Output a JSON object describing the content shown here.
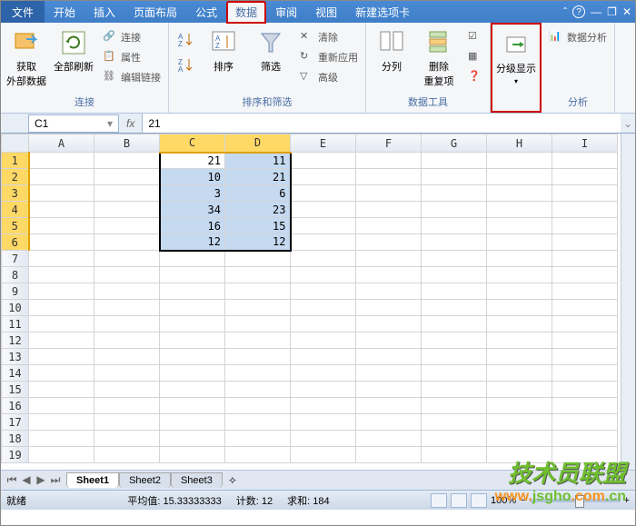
{
  "tabs": {
    "file": "文件",
    "items": [
      "开始",
      "插入",
      "页面布局",
      "公式",
      "数据",
      "审阅",
      "视图",
      "新建选项卡"
    ],
    "active": "数据"
  },
  "ribbon": {
    "group1": {
      "label": "连接",
      "get_external": "获取\n外部数据",
      "refresh_all": "全部刷新",
      "connections": "连接",
      "properties": "属性",
      "edit_links": "编辑链接"
    },
    "group2": {
      "label": "排序和筛选",
      "sort": "排序",
      "filter": "筛选",
      "clear": "清除",
      "reapply": "重新应用",
      "advanced": "高级"
    },
    "group3": {
      "label": "数据工具",
      "text_to_cols": "分列",
      "remove_dup": "删除\n重复项"
    },
    "group4": {
      "label": "",
      "outline": "分级显示"
    },
    "group5": {
      "label": "分析",
      "data_analysis": "数据分析"
    }
  },
  "name_box": "C1",
  "formula": "21",
  "columns": [
    "A",
    "B",
    "C",
    "D",
    "E",
    "F",
    "G",
    "H",
    "I"
  ],
  "rows": 19,
  "selection": {
    "startRow": 1,
    "endRow": 6,
    "startCol": "C",
    "endCol": "D",
    "activeCell": "C1"
  },
  "cells": {
    "C1": "21",
    "D1": "11",
    "C2": "10",
    "D2": "21",
    "C3": "3",
    "D3": "6",
    "C4": "34",
    "D4": "23",
    "C5": "16",
    "D5": "15",
    "C6": "12",
    "D6": "12"
  },
  "sheets": [
    "Sheet1",
    "Sheet2",
    "Sheet3"
  ],
  "active_sheet": "Sheet1",
  "status": {
    "ready": "就绪",
    "avg_label": "平均值:",
    "avg": "15.33333333",
    "count_label": "计数:",
    "count": "12",
    "sum_label": "求和:",
    "sum": "184",
    "zoom": "100%"
  },
  "watermark": {
    "line1": "技术员联盟",
    "line2_a": "www.",
    "line2_b": "jsgho",
    "line2_c": ".com",
    "line2_d": ".cn"
  },
  "chart_data": {
    "type": "table",
    "columns": [
      "C",
      "D"
    ],
    "rows": [
      [
        21,
        11
      ],
      [
        10,
        21
      ],
      [
        3,
        6
      ],
      [
        34,
        23
      ],
      [
        16,
        15
      ],
      [
        12,
        12
      ]
    ]
  }
}
